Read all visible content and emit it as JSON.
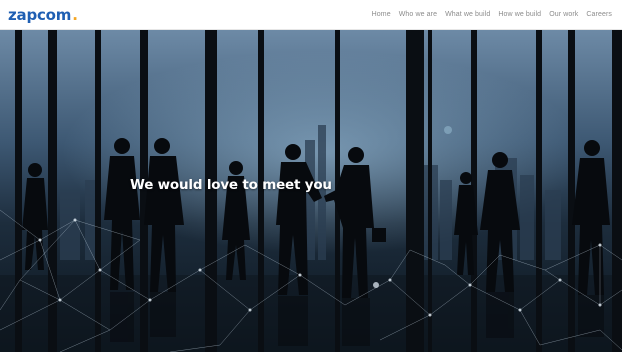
{
  "header": {
    "logo_text": "zapcom",
    "logo_dot": ".",
    "nav": [
      {
        "label": "Home"
      },
      {
        "label": "Who we are"
      },
      {
        "label": "What we build"
      },
      {
        "label": "How we build"
      },
      {
        "label": "Our work"
      },
      {
        "label": "Careers"
      }
    ]
  },
  "hero": {
    "headline": "We would love to meet you",
    "image_description_icon": "business-people-silhouettes-image"
  },
  "colors": {
    "logo": "#1f5fb3",
    "logo_dot": "#f5a623",
    "nav_text": "#8c8c8c"
  }
}
